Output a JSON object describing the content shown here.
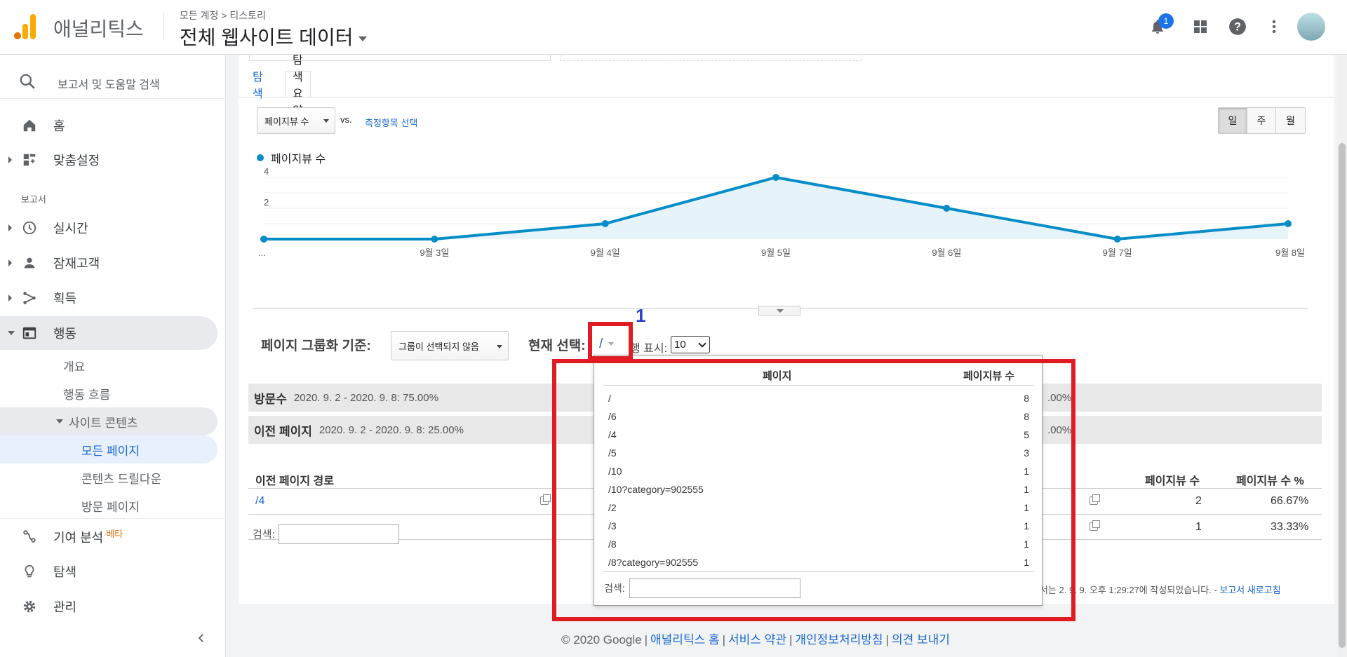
{
  "header": {
    "app_name": "애널리틱스",
    "breadcrumb": "모든 계정 > 티스토리",
    "property_name": "전체 웹사이트 데이터",
    "notification_count": "1"
  },
  "sidebar": {
    "search_placeholder": "보고서 및 도움말 검색",
    "top_items": [
      {
        "label": "홈",
        "icon": "home-icon"
      },
      {
        "label": "맞춤설정",
        "icon": "dashboard-icon"
      }
    ],
    "section_label": "보고서",
    "report_items": [
      {
        "label": "실시간",
        "icon": "clock-icon"
      },
      {
        "label": "잠재고객",
        "icon": "person-icon"
      },
      {
        "label": "획득",
        "icon": "acquisition-icon"
      },
      {
        "label": "행동",
        "icon": "behavior-icon"
      }
    ],
    "behavior_sub": {
      "overview": "개요",
      "flow": "행동 흐름",
      "site_content": "사이트 콘텐츠",
      "all_pages": "모든 페이지",
      "drilldown": "콘텐츠 드릴다운",
      "landing": "방문 페이지"
    },
    "bottom_items": [
      {
        "label": "기여 분석",
        "badge": "베타",
        "icon": "attribution-icon"
      },
      {
        "label": "탐색",
        "icon": "lightbulb-icon"
      },
      {
        "label": "관리",
        "icon": "gear-icon"
      }
    ]
  },
  "main": {
    "tabs": [
      "탐색",
      "탐색 요약"
    ],
    "metric_select": "페이지뷰 수",
    "vs": "vs.",
    "metric_link": "측정항목 선택",
    "period": [
      "일",
      "주",
      "월"
    ],
    "legend": "페이지뷰 수",
    "grouping_label": "페이지 그룹화 기준:",
    "grouping_value": "그룹이 선택되지 않음",
    "current_label": "현재 선택:",
    "current_value": "/",
    "rows_label": "행 표시:",
    "rows_value": "10",
    "summary_rows": [
      {
        "title": "방문수",
        "detail": "2020. 9. 2 - 2020. 9. 8: 75.00%",
        "right": ".00%"
      },
      {
        "title": "이전 페이지",
        "detail": "2020. 9. 2 - 2020. 9. 8: 25.00%",
        "right": ".00%"
      }
    ],
    "table": {
      "col_path": "이전 페이지 경로",
      "col_views": "페이지뷰 수",
      "col_pct": "페이지뷰 수 %",
      "rows": [
        {
          "path": "/4",
          "views": "2",
          "pct": "66.67%"
        },
        {
          "path": "",
          "views": "1",
          "pct": "33.33%"
        }
      ]
    },
    "search_label": "검색:",
    "report_note_prefix": "서는 2",
    "report_note_mid": ". 9. 9. 오후 1:29:27에 작성되었습니다. - ",
    "report_note_link": "보고서 새로고침"
  },
  "popup": {
    "col_page": "페이지",
    "col_views": "페이지뷰 수",
    "rows": [
      {
        "page": "/",
        "views": "8"
      },
      {
        "page": "/6",
        "views": "8"
      },
      {
        "page": "/4",
        "views": "5"
      },
      {
        "page": "/5",
        "views": "3"
      },
      {
        "page": "/10",
        "views": "1"
      },
      {
        "page": "/10?category=902555",
        "views": "1"
      },
      {
        "page": "/2",
        "views": "1"
      },
      {
        "page": "/3",
        "views": "1"
      },
      {
        "page": "/8",
        "views": "1"
      },
      {
        "page": "/8?category=902555",
        "views": "1"
      }
    ],
    "search_label": "검색:"
  },
  "annotation": {
    "number": "1",
    "color": "#e01b24"
  },
  "footer": {
    "copyright": "© 2020 Google",
    "links": [
      "애널리틱스 홈",
      "서비스 약관",
      "개인정보처리방침",
      "의견 보내기"
    ]
  },
  "chart_data": {
    "type": "area",
    "x": [
      "...",
      "9월 3일",
      "9월 4일",
      "9월 5일",
      "9월 6일",
      "9월 7일",
      "9월 8일"
    ],
    "series": [
      {
        "name": "페이지뷰 수",
        "values": [
          0,
          0,
          1,
          4,
          2,
          0,
          1
        ]
      }
    ],
    "yticks": [
      "2",
      "4"
    ],
    "ylim": [
      0,
      4
    ],
    "color": "#058dc7",
    "grid": true
  }
}
